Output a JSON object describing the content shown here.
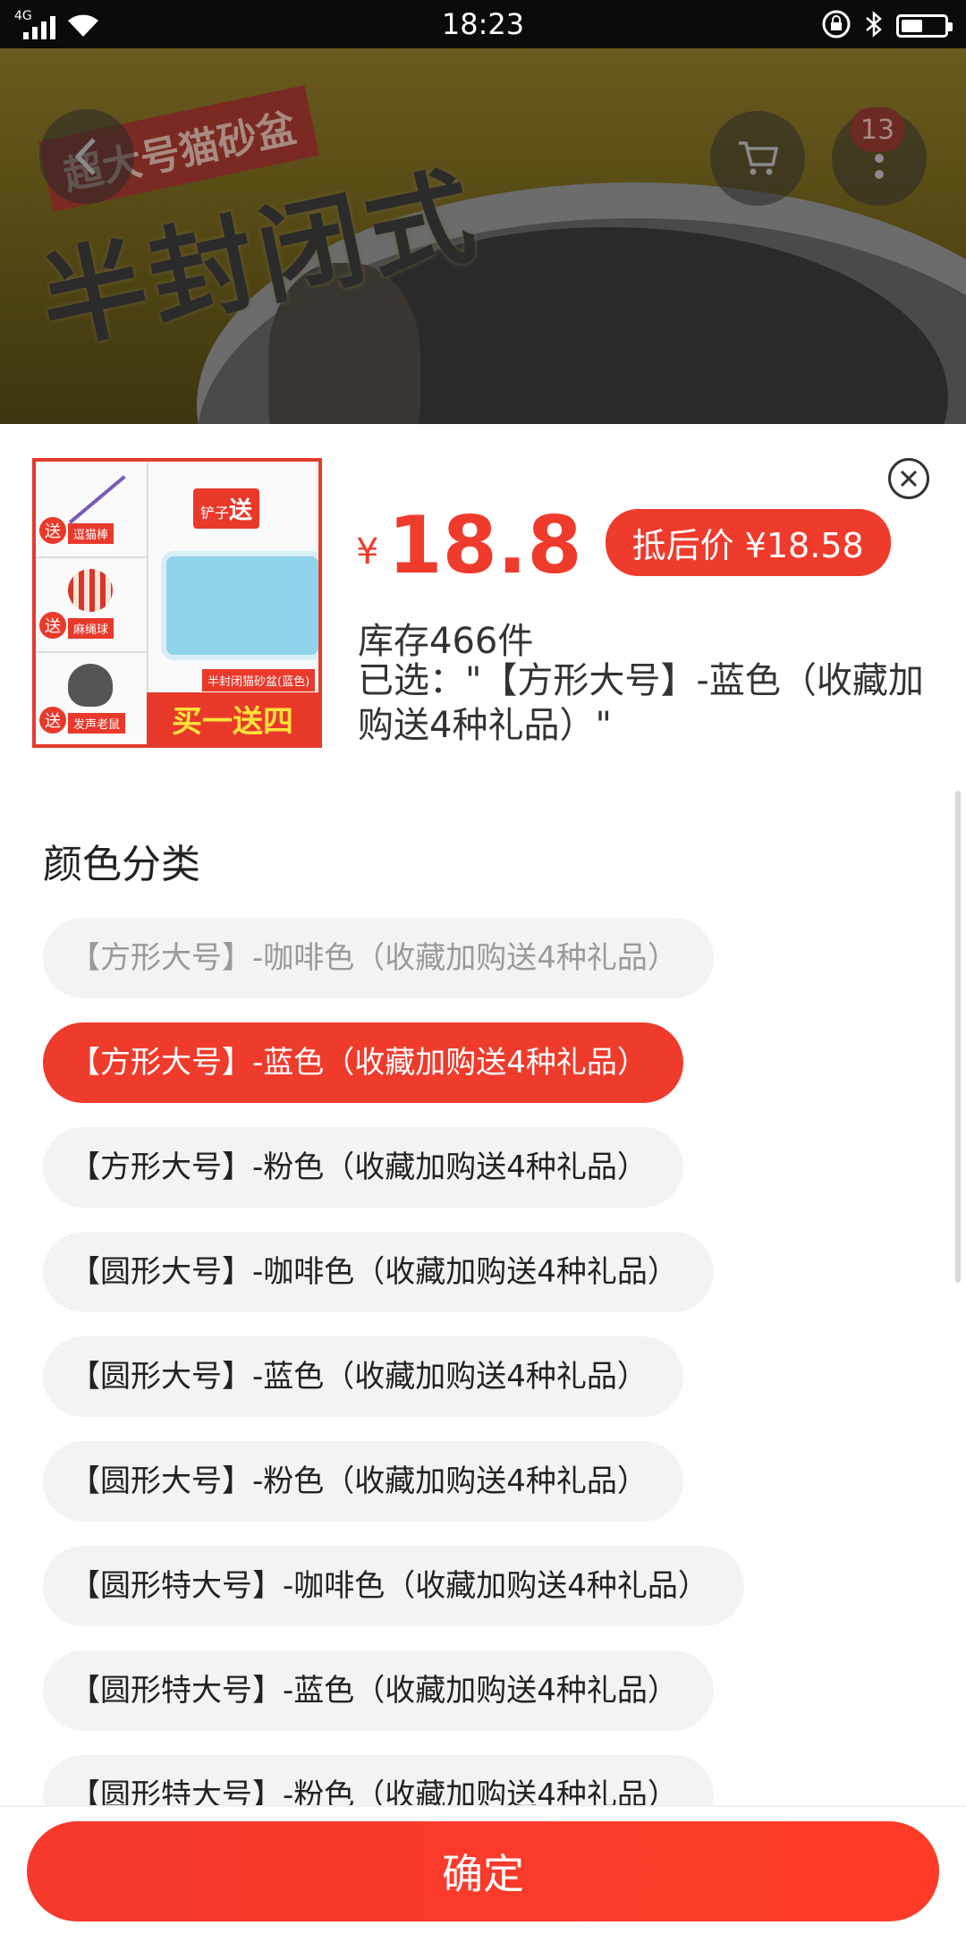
{
  "status_bar": {
    "network": "4G",
    "time": "18:23",
    "battery_level": 0.5
  },
  "banner": {
    "tag_text": "超大号猫砂盆",
    "headline": "半封闭式",
    "cart_badge": "13"
  },
  "product": {
    "thumbnail": {
      "gift1": "逗猫棒",
      "gift2": "麻绳球",
      "gift3": "发声老鼠",
      "send_label": "送",
      "shovel_label": "铲子",
      "product_label": "半封闭猫砂盆(蓝色)",
      "promo": "买一送四"
    },
    "currency": "¥",
    "price": "18.8",
    "after_discount": "抵后价 ¥18.58",
    "stock": "库存466件",
    "selected": "已选：\"【方形大号】-蓝色（收藏加购送4种礼品）\""
  },
  "section_title": "颜色分类",
  "options": [
    {
      "label": "【方形大号】-咖啡色（收藏加购送4种礼品）",
      "state": "disabled"
    },
    {
      "label": "【方形大号】-蓝色（收藏加购送4种礼品）",
      "state": "active"
    },
    {
      "label": "【方形大号】-粉色（收藏加购送4种礼品）",
      "state": "normal"
    },
    {
      "label": "【圆形大号】-咖啡色（收藏加购送4种礼品）",
      "state": "normal"
    },
    {
      "label": "【圆形大号】-蓝色（收藏加购送4种礼品）",
      "state": "normal"
    },
    {
      "label": "【圆形大号】-粉色（收藏加购送4种礼品）",
      "state": "normal"
    },
    {
      "label": "【圆形特大号】-咖啡色（收藏加购送4种礼品）",
      "state": "normal"
    },
    {
      "label": "【圆形特大号】-蓝色（收藏加购送4种礼品）",
      "state": "normal"
    },
    {
      "label": "【圆形特大号】-粉色（收藏加购送4种礼品）",
      "state": "normal"
    }
  ],
  "confirm_label": "确定",
  "colors": {
    "accent": "#ef3b2c",
    "chip_bg": "#f3f3f3"
  }
}
